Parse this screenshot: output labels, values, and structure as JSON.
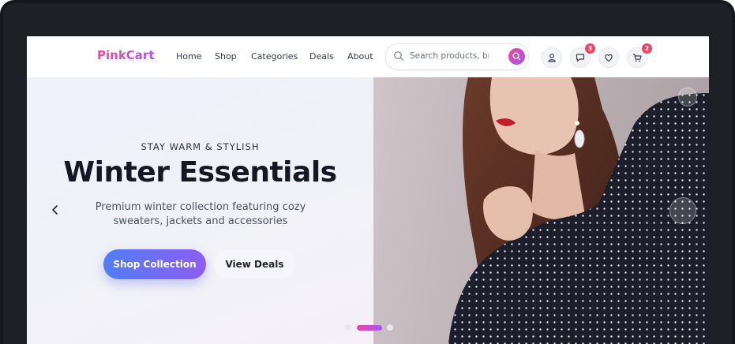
{
  "brand": {
    "name": "PinkCart"
  },
  "nav": [
    {
      "label": "Home"
    },
    {
      "label": "Shop"
    },
    {
      "label": "Categories"
    },
    {
      "label": "Deals"
    },
    {
      "label": "About"
    }
  ],
  "search": {
    "placeholder": "Search products, brands..."
  },
  "header_icons": {
    "notifications_count": "3",
    "cart_count": "2"
  },
  "hero": {
    "kicker": "STAY WARM & STYLISH",
    "title": "Winter Essentials",
    "subtitle": "Premium winter collection featuring cozy sweaters, jackets and accessories",
    "primary_cta": "Shop Collection",
    "secondary_cta": "View Deals"
  },
  "carousel": {
    "slides": 3,
    "active_slide": 2
  },
  "colors": {
    "brand_gradient_start": "#ec4899",
    "brand_gradient_end": "#a855f7",
    "primary_cta_start": "#4f7ef5",
    "primary_cta_end": "#8e5cf2",
    "badge": "#ef4461"
  }
}
